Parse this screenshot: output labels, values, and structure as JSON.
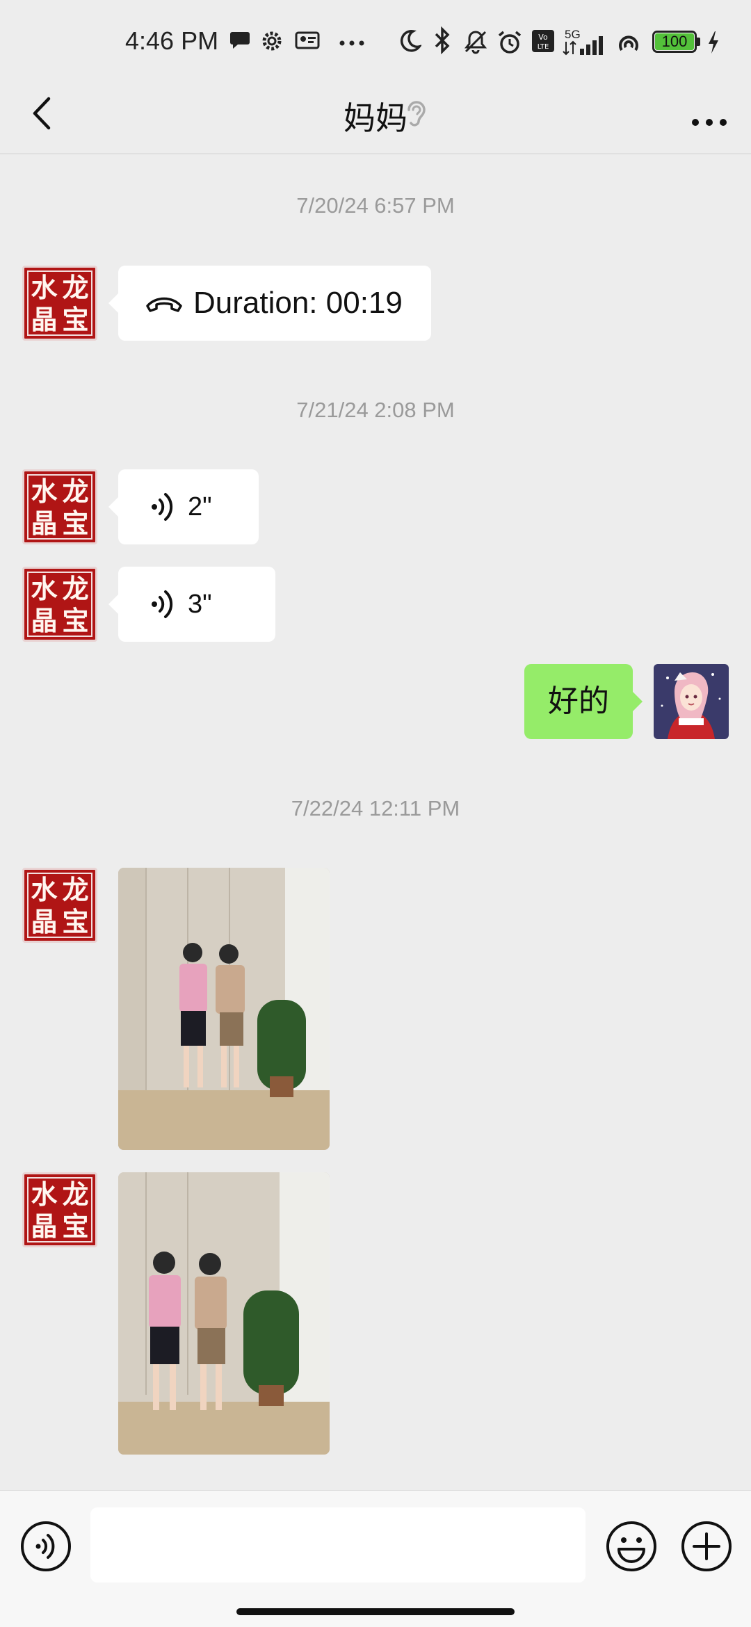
{
  "status_bar": {
    "time": "4:46 PM",
    "battery": "100",
    "network": "5G",
    "icons": [
      "chat-bubble-icon",
      "gear-icon",
      "id-card-icon",
      "more-dots-icon",
      "moon-icon",
      "bluetooth-icon",
      "bell-mute-icon",
      "alarm-icon",
      "volte-icon",
      "signal-icon",
      "hotspot-icon",
      "battery-icon",
      "charging-icon"
    ]
  },
  "header": {
    "title": "妈妈",
    "icons": [
      "back-arrow-icon",
      "ear-icon",
      "more-icon"
    ]
  },
  "messages": {
    "ts1": "7/20/24 6:57 PM",
    "call_text": "Duration: 00:19",
    "ts2": "7/21/24 2:08 PM",
    "voice1": "2\"",
    "voice2": "3\"",
    "reply_text": "好的",
    "ts3": "7/22/24 12:11 PM"
  },
  "contact_avatar_chars": [
    "水",
    "龙",
    "晶",
    "宝"
  ],
  "input_bar": {
    "icons": [
      "voice-mode-icon",
      "emoji-icon",
      "plus-icon"
    ]
  },
  "colors": {
    "background": "#ededed",
    "sent_bubble": "#95ec69",
    "received_bubble": "#ffffff",
    "avatar_red": "#b01515"
  }
}
